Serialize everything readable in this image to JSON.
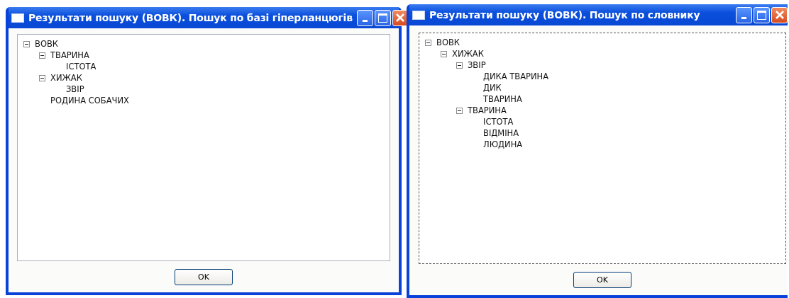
{
  "windows": [
    {
      "title": "Результати пошуку (ВОВК). Пошук по базі гіперланцюгів",
      "tree_focused": false,
      "tree": [
        {
          "label": "ВОВК",
          "expanded": true,
          "children": [
            {
              "label": "ТВАРИНА",
              "expanded": true,
              "children": [
                {
                  "label": "ІСТОТА"
                }
              ]
            },
            {
              "label": "ХИЖАК",
              "expanded": true,
              "children": [
                {
                  "label": "ЗВІР"
                }
              ]
            },
            {
              "label": "РОДИНА СОБАЧИХ"
            }
          ]
        }
      ],
      "button": "OK"
    },
    {
      "title": "Результати пошуку (ВОВК). Пошук по словнику",
      "tree_focused": true,
      "tree": [
        {
          "label": "ВОВК",
          "expanded": true,
          "children": [
            {
              "label": "ХИЖАК",
              "expanded": true,
              "children": [
                {
                  "label": "ЗВІР",
                  "expanded": true,
                  "children": [
                    {
                      "label": "ДИКА ТВАРИНА"
                    },
                    {
                      "label": "ДИК"
                    },
                    {
                      "label": "ТВАРИНА"
                    }
                  ]
                },
                {
                  "label": "ТВАРИНА",
                  "expanded": true,
                  "children": [
                    {
                      "label": "ІСТОТА"
                    },
                    {
                      "label": "ВІДМІНА"
                    },
                    {
                      "label": "ЛЮДИНА"
                    }
                  ]
                }
              ]
            }
          ]
        }
      ],
      "button": "OK"
    }
  ]
}
